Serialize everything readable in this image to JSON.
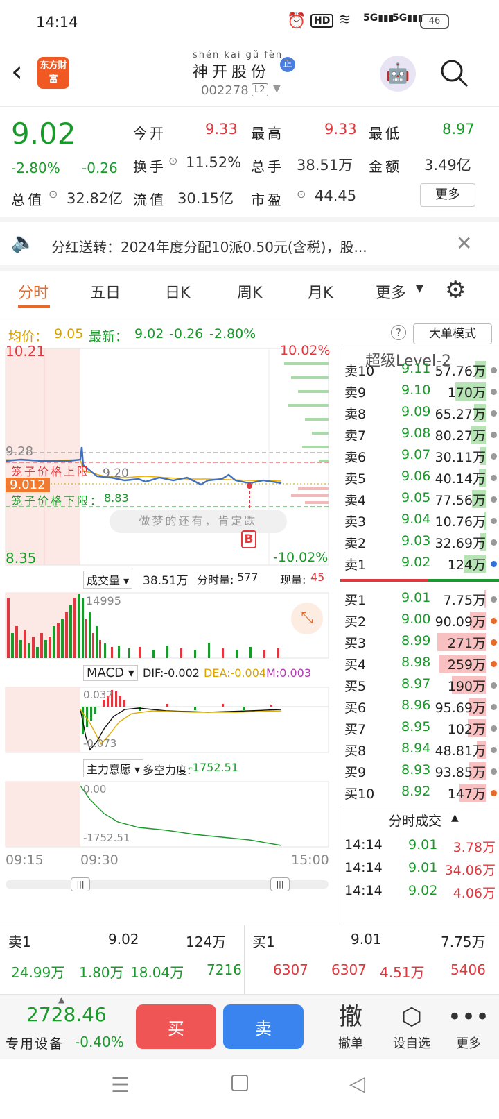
{
  "status": {
    "time": "14:14",
    "battery": "46"
  },
  "header": {
    "stock_name": "神开股份",
    "stock_name_pinyin": "shén kāi gǔ fèn",
    "stock_code": "002278",
    "level_badge": "L2",
    "zheng_badge": "正",
    "logo_text": "东方财富"
  },
  "quote": {
    "price": "9.02",
    "change_pct": "-2.80%",
    "change": "-0.26",
    "open_label": "今开",
    "open": "9.33",
    "high_label": "最高",
    "high": "9.33",
    "low_label": "最低",
    "low": "8.97",
    "turnover_label": "换手",
    "turnover": "11.52%",
    "volume_label": "总手",
    "volume": "38.51万",
    "amount_label": "金额",
    "amount": "3.49亿",
    "mktcap_label": "总值",
    "mktcap": "32.82亿",
    "float_label": "流值",
    "float": "30.15亿",
    "pe_label": "市盈",
    "pe": "44.45",
    "more_label": "更多"
  },
  "notice": {
    "text": "分红送转：2024年度分配10派0.50元(含税)，股..."
  },
  "tabs": [
    {
      "label": "分时"
    },
    {
      "label": "五日"
    },
    {
      "label": "日K"
    },
    {
      "label": "周K"
    },
    {
      "label": "月K"
    },
    {
      "label": "更多"
    }
  ],
  "avgbar": {
    "avg_label": "均价：",
    "avg": "9.05",
    "last_label": "最新：",
    "last": "9.02",
    "chg": "-0.26",
    "chg_pct": "-2.80%",
    "mode_button": "大单模式"
  },
  "chart": {
    "top_price": "10.21",
    "top_pct": "10.02%",
    "bottom_price": "8.35",
    "bottom_pct": "-10.02%",
    "level_928": "9.28",
    "upper_limit_label": "笼子价格上限",
    "lower_limit_label": "笼子价格下限：",
    "lower_limit": "8.83",
    "avg_mark": "9.20",
    "cur_tag": "9.012",
    "slogan": "做梦的还有，肯定跌",
    "marker": "B",
    "vol_label": "成交量",
    "vol_total": "38.51万",
    "vol_min_label": "分时量:",
    "vol_min": "577",
    "vol_now_label": "现量:",
    "vol_now": "45",
    "vol_max": "14995",
    "macd_label": "MACD",
    "dif": "DIF:-0.002",
    "dea": "DEA:-0.004",
    "m": "M:0.003",
    "macd_top": "0.032",
    "macd_bottom": "-0.073",
    "main_label": "主力意愿",
    "force_label": "多空力度:",
    "force": "-1752.51",
    "force_top": "0.00",
    "force_bottom": "-1752.51",
    "time_start": "09:15",
    "time_mid": "09:30",
    "time_end": "15:00"
  },
  "level2": {
    "title": "超级Level-2",
    "asks": [
      {
        "label": "卖10",
        "price": "9.11",
        "vol": "57.76万"
      },
      {
        "label": "卖9",
        "price": "9.10",
        "vol": "170万"
      },
      {
        "label": "卖8",
        "price": "9.09",
        "vol": "65.27万"
      },
      {
        "label": "卖7",
        "price": "9.08",
        "vol": "80.27万"
      },
      {
        "label": "卖6",
        "price": "9.07",
        "vol": "30.11万"
      },
      {
        "label": "卖5",
        "price": "9.06",
        "vol": "40.14万"
      },
      {
        "label": "卖4",
        "price": "9.05",
        "vol": "77.56万"
      },
      {
        "label": "卖3",
        "price": "9.04",
        "vol": "10.76万"
      },
      {
        "label": "卖2",
        "price": "9.03",
        "vol": "32.69万"
      },
      {
        "label": "卖1",
        "price": "9.02",
        "vol": "124万"
      }
    ],
    "bids": [
      {
        "label": "买1",
        "price": "9.01",
        "vol": "7.75万"
      },
      {
        "label": "买2",
        "price": "9.00",
        "vol": "90.09万"
      },
      {
        "label": "买3",
        "price": "8.99",
        "vol": "271万"
      },
      {
        "label": "买4",
        "price": "8.98",
        "vol": "259万"
      },
      {
        "label": "买5",
        "price": "8.97",
        "vol": "190万"
      },
      {
        "label": "买6",
        "price": "8.96",
        "vol": "95.69万"
      },
      {
        "label": "买7",
        "price": "8.95",
        "vol": "102万"
      },
      {
        "label": "买8",
        "price": "8.94",
        "vol": "48.81万"
      },
      {
        "label": "买9",
        "price": "8.93",
        "vol": "93.85万"
      },
      {
        "label": "买10",
        "price": "8.92",
        "vol": "147万"
      }
    ],
    "trades_title": "分时成交",
    "trades": [
      {
        "time": "14:14",
        "price": "9.01",
        "vol": "3.78万"
      },
      {
        "time": "14:14",
        "price": "9.01",
        "vol": "34.06万"
      },
      {
        "time": "14:14",
        "price": "9.02",
        "vol": "4.06万"
      }
    ]
  },
  "bottom": {
    "sell1_label": "卖1",
    "sell1_price": "9.02",
    "sell1_vol": "124万",
    "buy1_label": "买1",
    "buy1_price": "9.01",
    "buy1_vol": "7.75万",
    "row2": [
      "24.99万",
      "1.80万",
      "18.04万",
      "7216",
      "6307",
      "6307",
      "4.51万",
      "5406"
    ]
  },
  "toolbar": {
    "index_value": "2728.46",
    "index_name": "专用设备",
    "index_pct": "-0.40%",
    "buy": "买",
    "sell": "卖",
    "cancel_glyph": "撤",
    "cancel": "撤单",
    "watch": "设自选",
    "more": "更多"
  }
}
